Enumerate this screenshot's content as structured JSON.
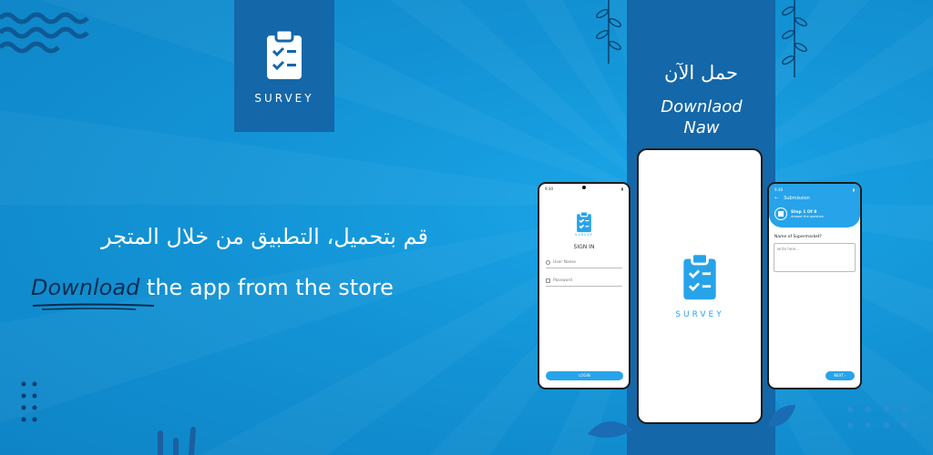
{
  "logo": {
    "label": "SURVEY",
    "icon": "clipboard-check-icon"
  },
  "download_band": {
    "arabic": "حمل الآن",
    "english": "Downlaod Naw"
  },
  "headline": {
    "arabic": "قم بتحميل، التطبيق من خلال المتجر",
    "english_emphasis": "Download",
    "english_rest": " the app from the store"
  },
  "phone_left": {
    "time": "9:30",
    "title": "SIGN IN",
    "username_placeholder": "User Name",
    "password_placeholder": "Password",
    "login_label": "LOGIN"
  },
  "phone_center": {
    "label": "SURVEY"
  },
  "phone_right": {
    "time": "9:30",
    "header_title": "Submission",
    "step_label": "Step 1 Of 8",
    "step_sub": "Answer the question",
    "question": "Name of Supermarket?",
    "answer_placeholder": "write here...",
    "next_label": "NEXT"
  },
  "colors": {
    "background": "#1394d6",
    "band": "#1467a8",
    "accent": "#27a3ea",
    "emphasis_text": "#0c2d4f"
  }
}
